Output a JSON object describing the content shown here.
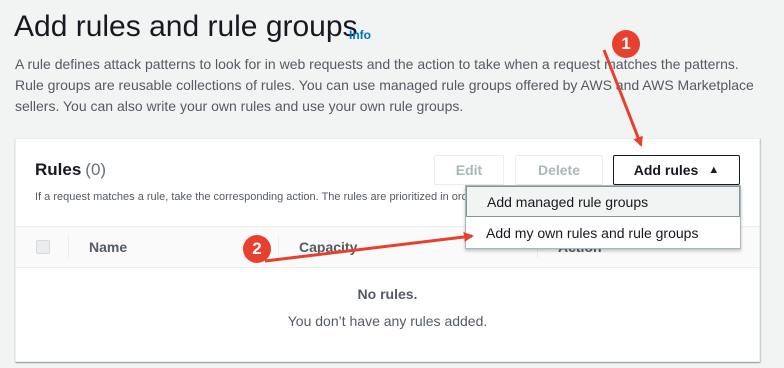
{
  "header": {
    "title": "Add rules and rule groups",
    "info_label": "Info",
    "description": "A rule defines attack patterns to look for in web requests and the action to take when a request matches the patterns. Rule groups are reusable collections of rules. You can use managed rule groups offered by AWS and AWS Marketplace sellers. You can also write your own rules and use your own rule groups."
  },
  "rules_panel": {
    "heading": "Rules",
    "count": "(0)",
    "helper_text": "If a request matches a rule, take the corresponding action. The rules are prioritized in order they appear.",
    "edit_label": "Edit",
    "delete_label": "Delete",
    "add_rules_label": "Add rules",
    "columns": [
      "Name",
      "Capacity",
      "Action"
    ],
    "empty_title": "No rules.",
    "empty_text": "You don’t have any rules added."
  },
  "dropdown": {
    "items": [
      {
        "label": "Add managed rule groups"
      },
      {
        "label": "Add my own rules and rule groups"
      }
    ]
  },
  "annotations": {
    "step1": "1",
    "step2": "2",
    "color": "#e8402f"
  },
  "icons": {
    "add_rules_caret": "caret-up-icon"
  }
}
